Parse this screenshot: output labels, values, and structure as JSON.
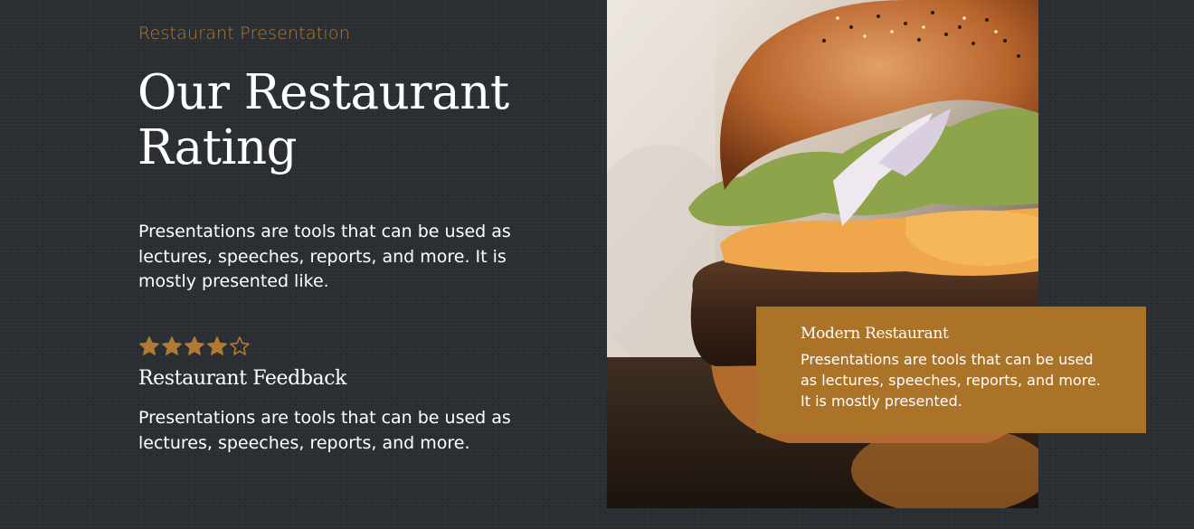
{
  "header": {
    "eyebrow": "Restaurant Presentation",
    "title": "Our Restaurant Rating",
    "intro": "Presentations are tools that can be used as lectures, speeches, reports, and more. It is mostly presented like."
  },
  "rating": {
    "stars_filled": 4,
    "stars_total": 5,
    "star_color": "#b07a32"
  },
  "feedback": {
    "title": "Restaurant Feedback",
    "text": "Presentations are tools that can be used as lectures, speeches, reports, and more."
  },
  "card": {
    "title": "Modern Restaurant",
    "text": "Presentations are tools that can be used as lectures, speeches, reports, and more. It is mostly presented.",
    "color": "#ab7328"
  },
  "colors": {
    "background": "#2b2f33",
    "accent": "#b07a32"
  }
}
